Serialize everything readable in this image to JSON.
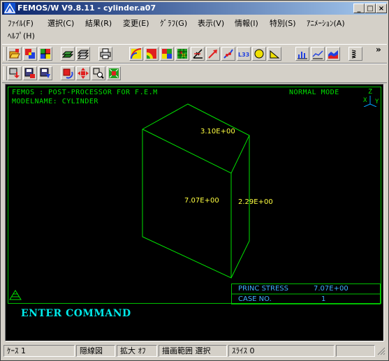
{
  "window": {
    "title": "FEMOS/W V9.8.11 - cylinder.a07",
    "minimize_glyph": "_",
    "maximize_glyph": "□",
    "close_glyph": "×"
  },
  "menu": {
    "items": [
      "ﾌｧｲﾙ(F)",
      "選択(C)",
      "結果(R)",
      "変更(E)",
      "ｸﾞﾗﾌ(G)",
      "表示(V)",
      "情報(I)",
      "特別(S)",
      "ｱﾆﾒｰｼｮﾝ(A)",
      "ﾍﾙﾌﾟ(H)"
    ]
  },
  "toolbar": {
    "row1_icons": [
      "open-model-icon",
      "select-icon",
      "mesh-icon",
      "layer-icon",
      "layers-icon",
      "print-icon",
      "contour-icon",
      "contour-fill-icon",
      "element-color-icon",
      "grid-color-icon",
      "axis-icon",
      "vector-icon",
      "deform-icon",
      "label-icon",
      "circle-icon",
      "tri-icon",
      "graph-bar-icon",
      "graph-line-icon",
      "graph-area-icon",
      "coil-icon"
    ],
    "row1_text_labels": {
      "label_icon_text": "L33"
    },
    "row2_icons": [
      "load-down-icon",
      "save-icon",
      "save-as-icon",
      "rotate-icon",
      "move-icon",
      "zoom-icon",
      "fit-icon"
    ],
    "overflow": "»"
  },
  "viewport": {
    "header_left": "FEMOS  : POST-PROCESSOR  FOR  F.E.M",
    "model_line": "MODELNAME: CYLINDER",
    "mode": "NORMAL MODE",
    "axis_z": "Z",
    "axis_x": "X",
    "axis_y": "Y",
    "value_top": "3.10E+00",
    "value_left": "7.07E+00",
    "value_right": "2.29E+00",
    "info_label_1": "PRINC STRESS",
    "info_value_1": "7.07E+00",
    "info_label_2": "CASE NO.",
    "info_value_2": "1",
    "command": "ENTER COMMAND"
  },
  "status": {
    "case": "ｹｰｽ 1",
    "view": "隠線図",
    "zoom": "拡大 ｵﾌ",
    "range": "描画範囲 選択",
    "slice": "ｽﾗｲｽ 0"
  },
  "colors": {
    "title_gradient_start": "#0a246a",
    "wireframe": "#00e000",
    "values": "#ffff40",
    "command": "#00e8e8",
    "background": "#000000"
  }
}
